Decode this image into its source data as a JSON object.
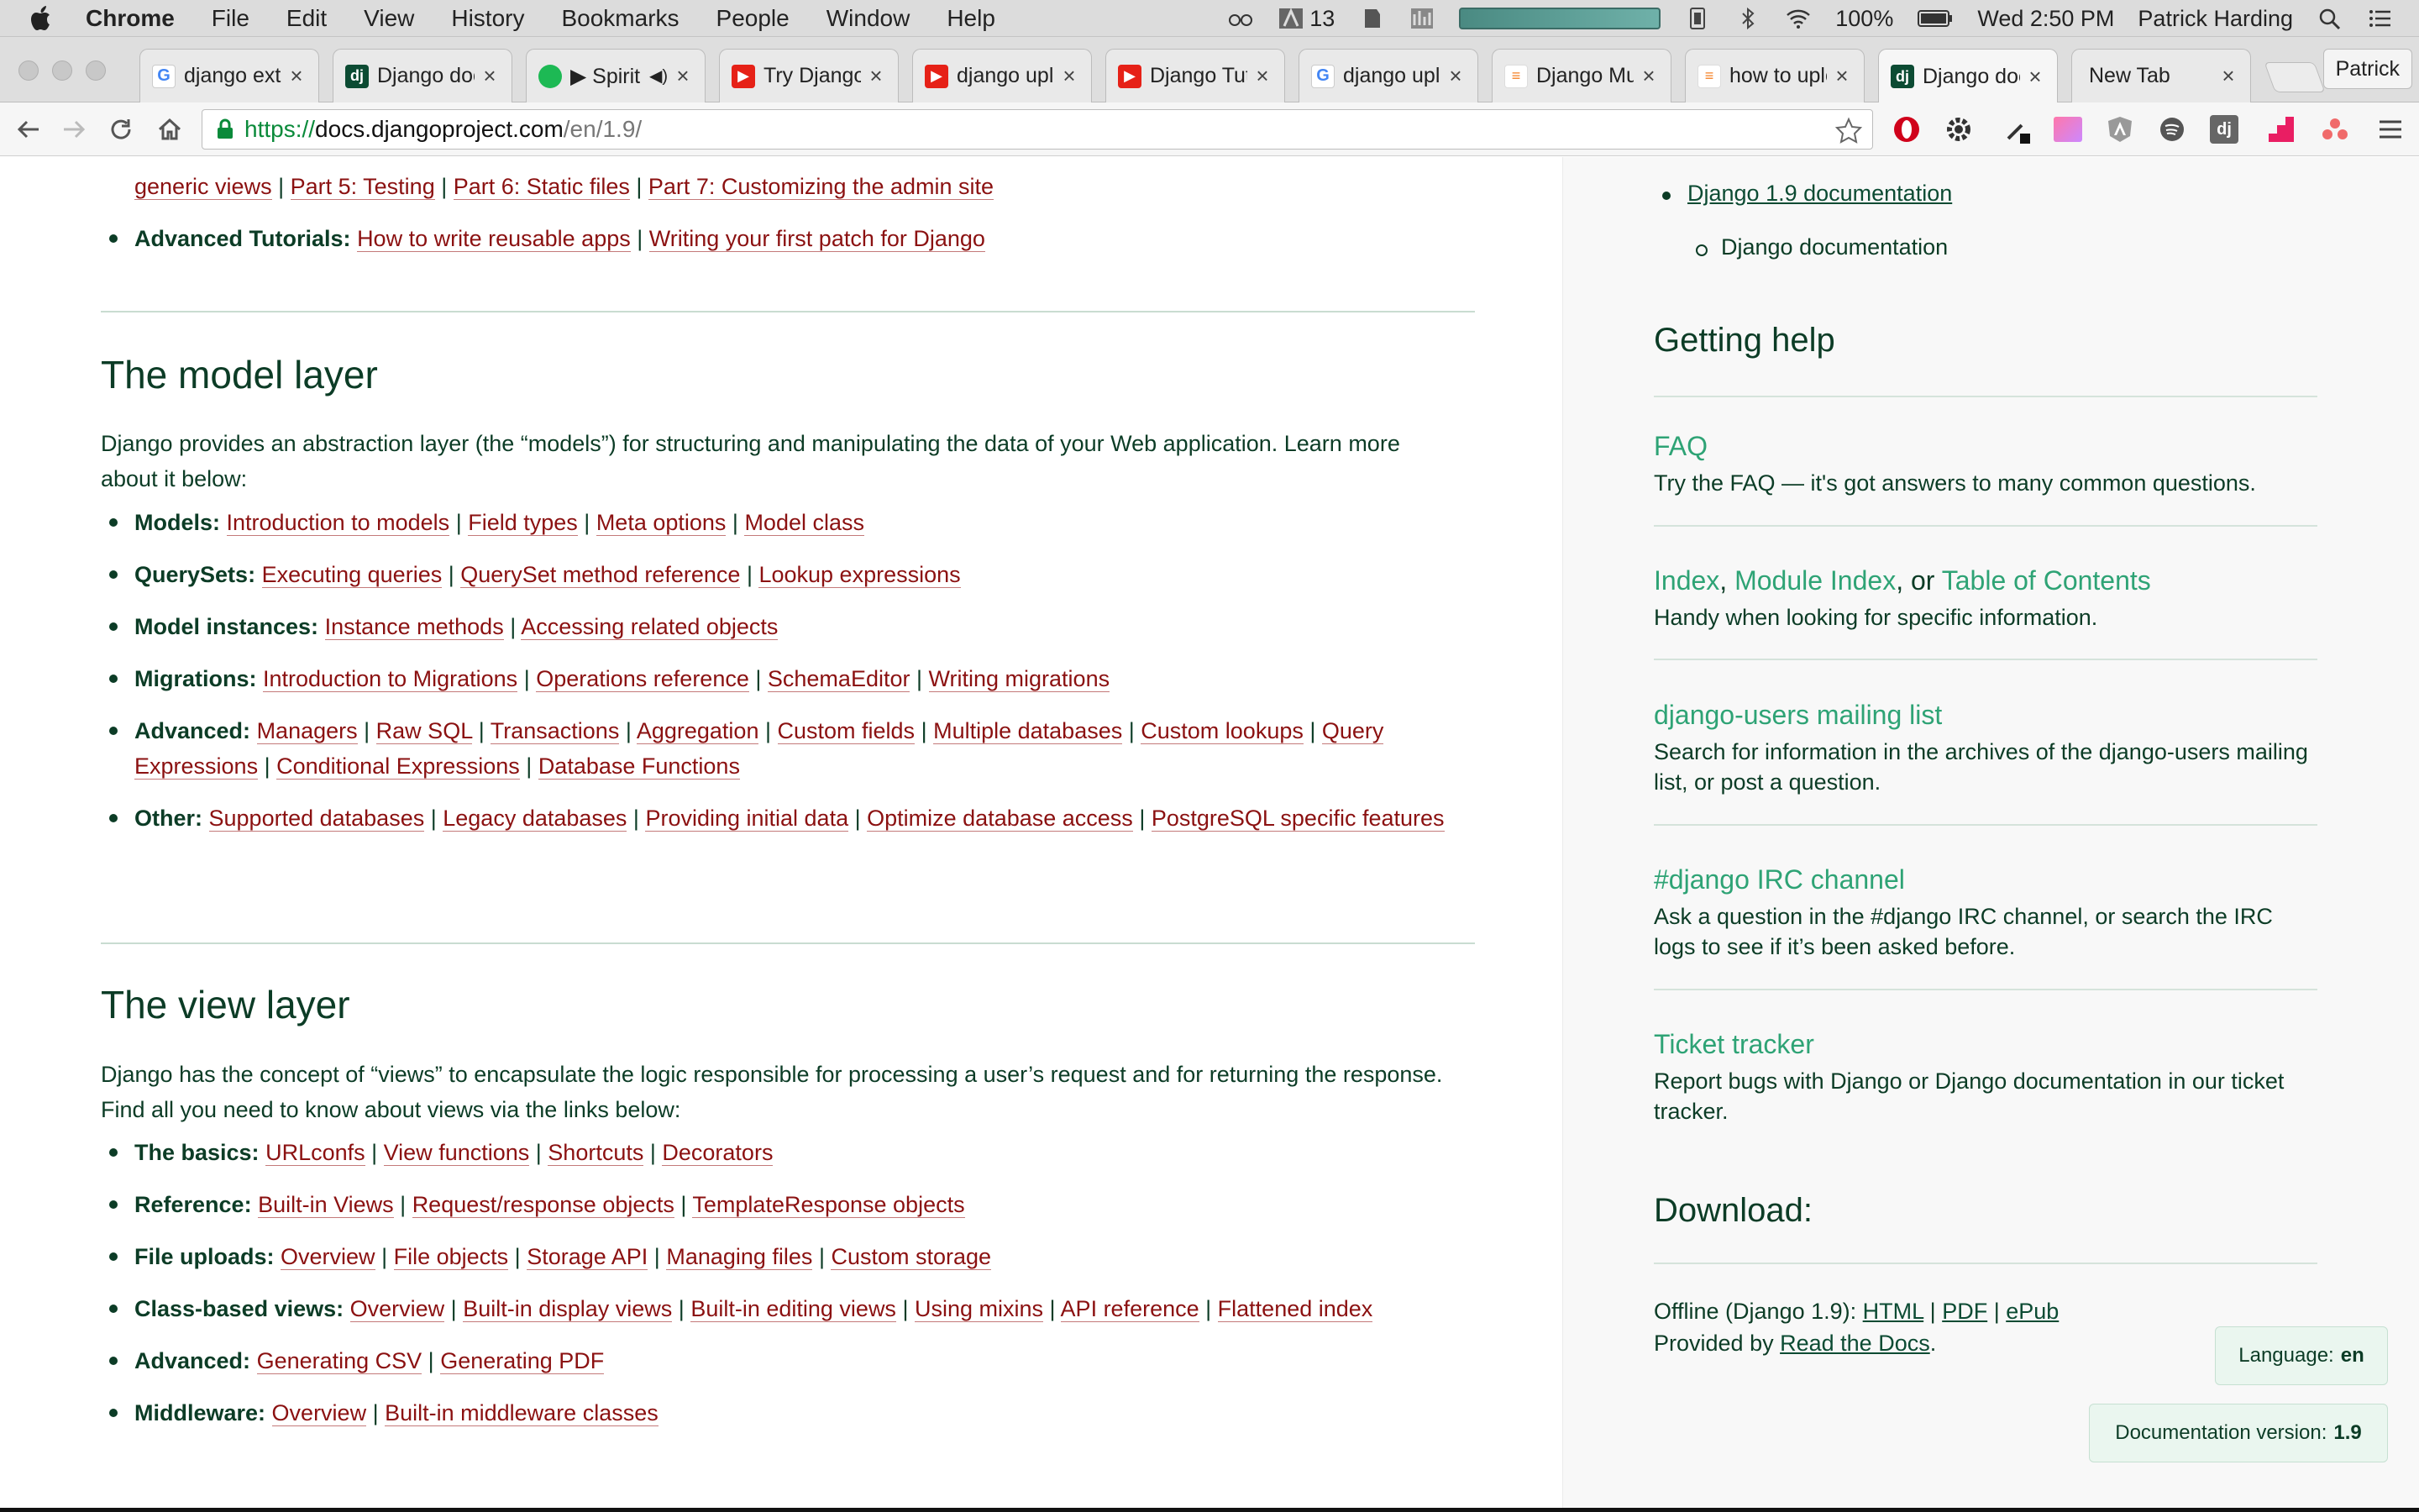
{
  "menubar": {
    "app": "Chrome",
    "items": [
      "File",
      "Edit",
      "View",
      "History",
      "Bookmarks",
      "People",
      "Window",
      "Help"
    ],
    "status_count": "13",
    "battery": "100%",
    "clock": "Wed 2:50 PM",
    "user": "Patrick Harding"
  },
  "tabs": [
    {
      "label": "django exte",
      "icon": "google-icon"
    },
    {
      "label": "Django doc",
      "icon": "django-icon"
    },
    {
      "label": "▶ Spirit (",
      "icon": "spotify-icon"
    },
    {
      "label": "Try Django",
      "icon": "youtube-icon"
    },
    {
      "label": "django uplo",
      "icon": "youtube-icon"
    },
    {
      "label": "Django Tuto",
      "icon": "youtube-icon"
    },
    {
      "label": "django uplo",
      "icon": "google-icon"
    },
    {
      "label": "Django Mult",
      "icon": "stackoverflow-icon"
    },
    {
      "label": "how to uplo",
      "icon": "stackoverflow-icon"
    },
    {
      "label": "Django doc",
      "icon": "django-icon"
    },
    {
      "label": "New Tab",
      "icon": ""
    }
  ],
  "profile": "Patrick",
  "url": {
    "scheme": "https://",
    "host": "docs.djangoproject.com",
    "path": "/en/1.9/"
  },
  "main": {
    "top_items": {
      "line1_links": [
        "generic views",
        "Part 5: Testing",
        "Part 6: Static files",
        "Part 7: Customizing the admin site"
      ],
      "advanced_tutorials": {
        "label": "Advanced Tutorials:",
        "links": [
          "How to write reusable apps",
          "Writing your first patch for Django"
        ]
      }
    },
    "model": {
      "title": "The model layer",
      "intro": "Django provides an abstraction layer (the “models”) for structuring and manipulating the data of your Web application. Learn more about it below:",
      "items": [
        {
          "label": "Models:",
          "links": [
            "Introduction to models",
            "Field types",
            "Meta options",
            "Model class"
          ]
        },
        {
          "label": "QuerySets:",
          "links": [
            "Executing queries",
            "QuerySet method reference",
            "Lookup expressions"
          ]
        },
        {
          "label": "Model instances:",
          "links": [
            "Instance methods",
            "Accessing related objects"
          ]
        },
        {
          "label": "Migrations:",
          "links": [
            "Introduction to Migrations",
            "Operations reference",
            "SchemaEditor",
            "Writing migrations"
          ]
        },
        {
          "label": "Advanced:",
          "links": [
            "Managers",
            "Raw SQL",
            "Transactions",
            "Aggregation",
            "Custom fields",
            "Multiple databases",
            "Custom lookups",
            "Query Expressions",
            "Conditional Expressions",
            "Database Functions"
          ]
        },
        {
          "label": "Other:",
          "links": [
            "Supported databases",
            "Legacy databases",
            "Providing initial data",
            "Optimize database access",
            "PostgreSQL specific features"
          ]
        }
      ]
    },
    "view": {
      "title": "The view layer",
      "intro": "Django has the concept of “views” to encapsulate the logic responsible for processing a user’s request and for returning the response. Find all you need to know about views via the links below:",
      "items": [
        {
          "label": "The basics:",
          "links": [
            "URLconfs",
            "View functions",
            "Shortcuts",
            "Decorators"
          ]
        },
        {
          "label": "Reference:",
          "links": [
            "Built-in Views",
            "Request/response objects",
            "TemplateResponse objects"
          ]
        },
        {
          "label": "File uploads:",
          "links": [
            "Overview",
            "File objects",
            "Storage API",
            "Managing files",
            "Custom storage"
          ]
        },
        {
          "label": "Class-based views:",
          "links": [
            "Overview",
            "Built-in display views",
            "Built-in editing views",
            "Using mixins",
            "API reference",
            "Flattened index"
          ]
        },
        {
          "label": "Advanced:",
          "links": [
            "Generating CSV",
            "Generating PDF"
          ]
        },
        {
          "label": "Middleware:",
          "links": [
            "Overview",
            "Built-in middleware classes"
          ]
        }
      ]
    }
  },
  "sidebar": {
    "nav_link": "Django 1.9 documentation",
    "nav_current": "Django documentation",
    "help_title": "Getting help",
    "faq": {
      "title": "FAQ",
      "desc": "Try the FAQ — it's got answers to many common questions."
    },
    "index": {
      "link1": "Index",
      "sep1": ",",
      "link2": "Module Index",
      "sep2": ", or",
      "link3": "Table of Contents",
      "desc": "Handy when looking for specific information."
    },
    "mailing": {
      "title": "django-users mailing list",
      "desc": "Search for information in the archives of the django-users mailing list, or post a question."
    },
    "irc": {
      "title": "#django IRC channel",
      "desc": "Ask a question in the #django IRC channel, or search the IRC logs to see if it’s been asked before."
    },
    "tracker": {
      "title": "Ticket tracker",
      "desc": "Report bugs with Django or Django documentation in our ticket tracker."
    },
    "download_title": "Download:",
    "offline_prefix": "Offline (Django 1.9):",
    "offline_links": [
      "HTML",
      "PDF",
      "ePub"
    ],
    "provided_prefix": "Provided by",
    "provided_link": "Read the Docs",
    "provided_suffix": ".",
    "language_label": "Language:",
    "language_value": "en",
    "version_label": "Documentation version:",
    "version_value": "1.9"
  }
}
